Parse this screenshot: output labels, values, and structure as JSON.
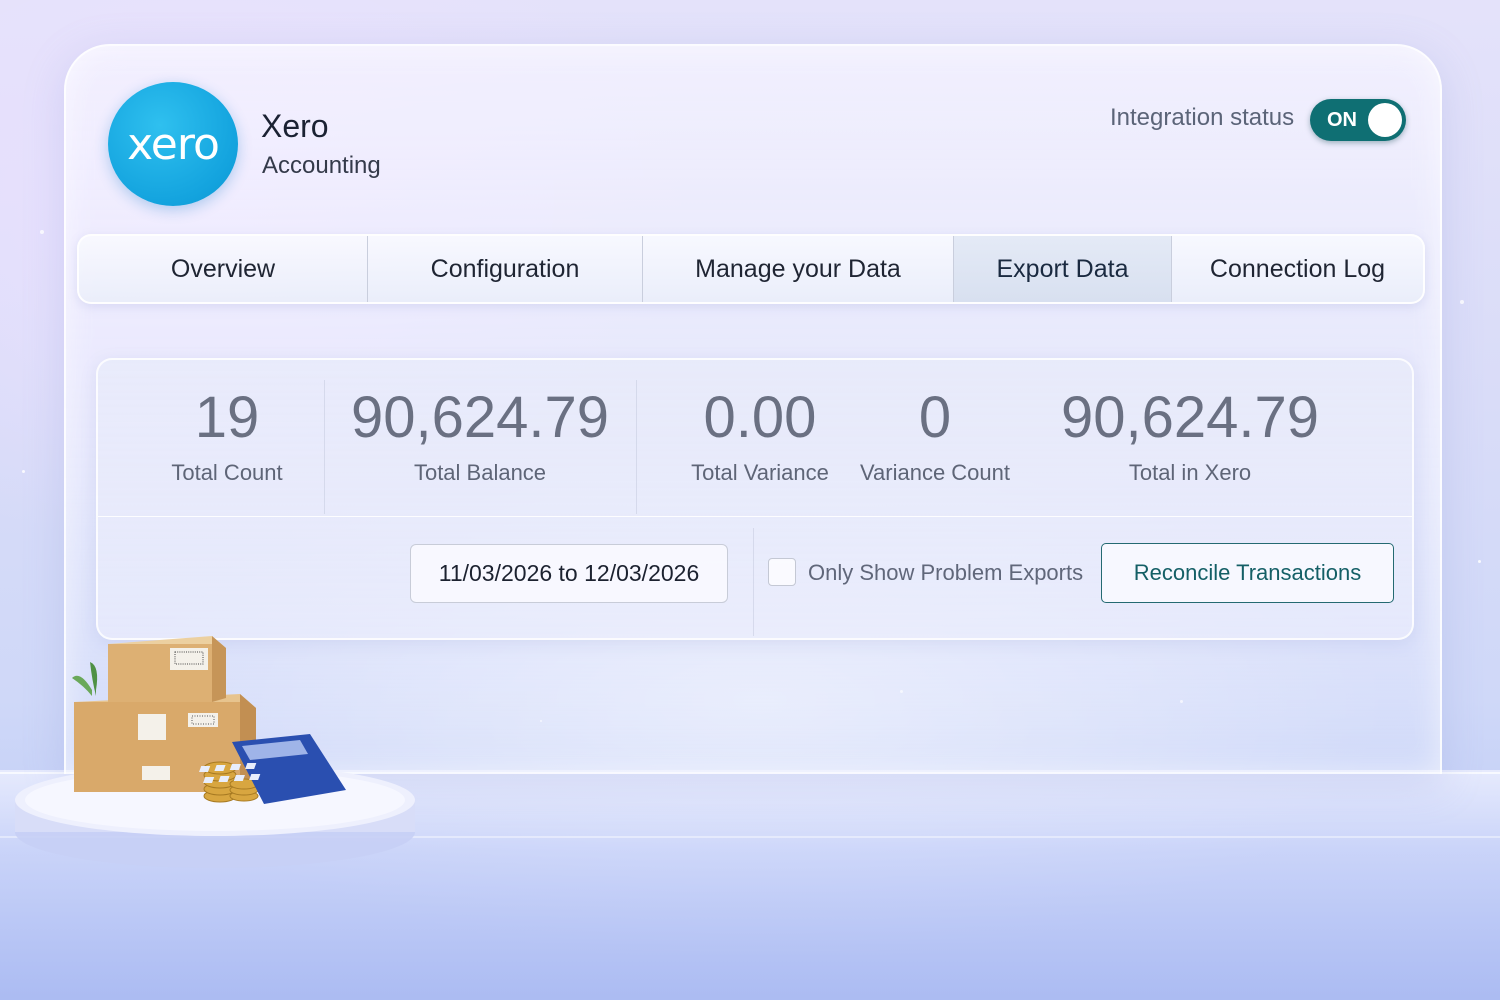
{
  "app": {
    "logo_text": "xero",
    "title": "Xero",
    "subtitle": "Accounting"
  },
  "integration": {
    "label": "Integration status",
    "toggle_text": "ON",
    "enabled": true,
    "toggle_color": "#0f6f73"
  },
  "tabs": [
    {
      "label": "Overview",
      "active": false
    },
    {
      "label": "Configuration",
      "active": false
    },
    {
      "label": "Manage your Data",
      "active": false
    },
    {
      "label": "Export Data",
      "active": true
    },
    {
      "label": "Connection Log",
      "active": false
    }
  ],
  "stats": [
    {
      "value": "19",
      "label": "Total Count"
    },
    {
      "value": "90,624.79",
      "label": "Total Balance"
    },
    {
      "value": "0.00",
      "label": "Total Variance"
    },
    {
      "value": "0",
      "label": "Variance Count"
    },
    {
      "value": "90,624.79",
      "label": "Total in Xero"
    }
  ],
  "filters": {
    "date_range": "11/03/2026 to 12/03/2026",
    "problem_exports_label": "Only Show Problem Exports",
    "problem_exports_checked": false,
    "reconcile_label": "Reconcile Transactions"
  },
  "colors": {
    "brand_blue": "#13a3de",
    "accent_teal": "#145f66"
  },
  "icons": {
    "logo": "xero-logo",
    "illustration": "boxes-calculator-coins-illustration"
  }
}
